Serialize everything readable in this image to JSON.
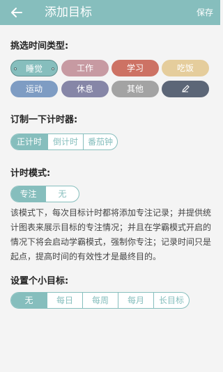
{
  "header": {
    "title": "添加目标",
    "save_label": "保存",
    "back_icon": "back-arrow-icon"
  },
  "time_type": {
    "heading": "挑选时间类型:",
    "tags": [
      {
        "label": "睡觉",
        "color": "#86bebd",
        "selected": true
      },
      {
        "label": "工作",
        "color": "#c79aa2",
        "selected": false
      },
      {
        "label": "学习",
        "color": "#cd7264",
        "selected": false
      },
      {
        "label": "吃饭",
        "color": "#e5cd9c",
        "selected": false
      },
      {
        "label": "运动",
        "color": "#7e9cc3",
        "selected": false
      },
      {
        "label": "休息",
        "color": "#8686a7",
        "selected": false
      },
      {
        "label": "其他",
        "color": "#a3a3a3",
        "selected": false
      },
      {
        "label": "",
        "color": "#5c6677",
        "icon": "pencil-icon",
        "selected": false
      }
    ]
  },
  "timer": {
    "heading": "订制一下计时器:",
    "options": [
      "正计时",
      "倒计时",
      "番茄钟"
    ],
    "selected": 0
  },
  "mode": {
    "heading": "计时模式:",
    "options": [
      "专注",
      "无"
    ],
    "selected": 0,
    "description": "该模式下，每次目标计时都将添加专注记录；并提供统计图表来展示目标的专注情况；并且在学霸模式开启的情况下将会启动学霸模式，强制你专注；记录时间只是起点，提高时间的有效性才是最终目的。"
  },
  "goal": {
    "heading": "设置个小目标:",
    "options": [
      "无",
      "每日",
      "每周",
      "每月",
      "长目标"
    ],
    "selected": 0
  },
  "colors": {
    "accent": "#86bebd",
    "background": "#f4f4f4"
  }
}
